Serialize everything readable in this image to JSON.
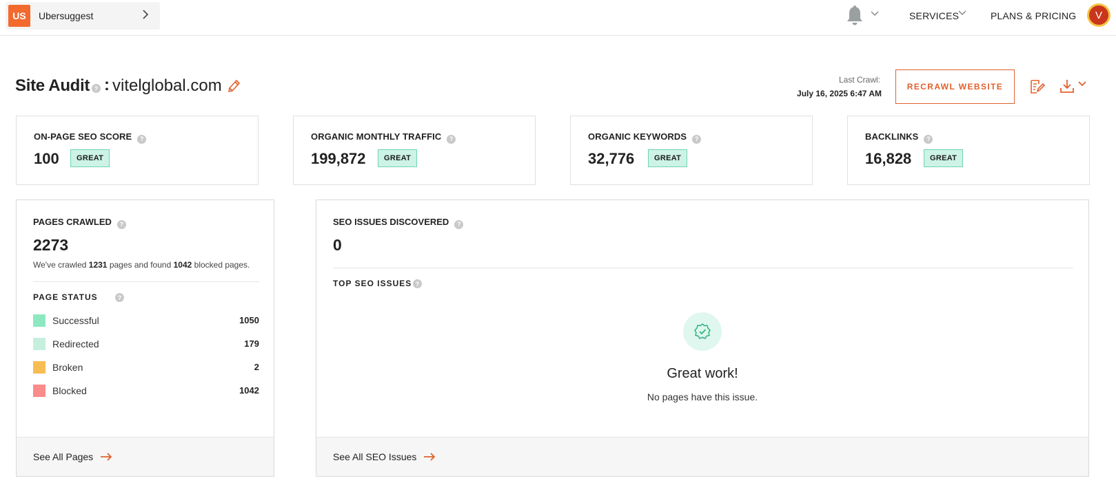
{
  "topbar": {
    "project_logo": "US",
    "project_name": "Ubersuggest",
    "services": "SERVICES",
    "plans_pricing": "PLANS & PRICING",
    "avatar_initial": "V"
  },
  "header": {
    "title": "Site Audit",
    "colon": ":",
    "domain": "vitelglobal.com",
    "last_crawl_label": "Last Crawl:",
    "last_crawl_date": "July 16, 2025 6:47 AM",
    "recrawl_label": "RECRAWL WEBSITE"
  },
  "metrics": [
    {
      "label": "ON-PAGE SEO SCORE",
      "value": "100",
      "badge": "GREAT"
    },
    {
      "label": "ORGANIC MONTHLY TRAFFIC",
      "value": "199,872",
      "badge": "GREAT"
    },
    {
      "label": "ORGANIC KEYWORDS",
      "value": "32,776",
      "badge": "GREAT"
    },
    {
      "label": "BACKLINKS",
      "value": "16,828",
      "badge": "GREAT"
    }
  ],
  "pages": {
    "label": "PAGES CRAWLED",
    "value": "2273",
    "desc_prefix": "We've crawled",
    "crawled": "1231",
    "desc_mid": "pages and found",
    "blocked": "1042",
    "desc_suffix": "blocked pages.",
    "status_label": "PAGE STATUS",
    "statuses": [
      {
        "name": "Successful",
        "count": "1050",
        "color": "#8de8c1"
      },
      {
        "name": "Redirected",
        "count": "179",
        "color": "#c7efde"
      },
      {
        "name": "Broken",
        "count": "2",
        "color": "#f7bd55"
      },
      {
        "name": "Blocked",
        "count": "1042",
        "color": "#f98b8b"
      }
    ],
    "footer_link": "See All Pages"
  },
  "seo": {
    "label": "SEO ISSUES DISCOVERED",
    "value": "0",
    "top_label": "TOP SEO ISSUES",
    "great_title": "Great work!",
    "great_sub": "No pages have this issue.",
    "footer_link": "See All SEO Issues"
  },
  "colors": {
    "accent": "#e0612d",
    "badge_bg": "#ccf3e6",
    "success_icon": "#2bb37f"
  },
  "icons": {
    "bell": "bell-icon",
    "edit": "pencil-icon",
    "report": "report-edit-icon",
    "download": "download-icon",
    "success": "badge-check-icon",
    "arrow": "arrow-right-icon"
  }
}
